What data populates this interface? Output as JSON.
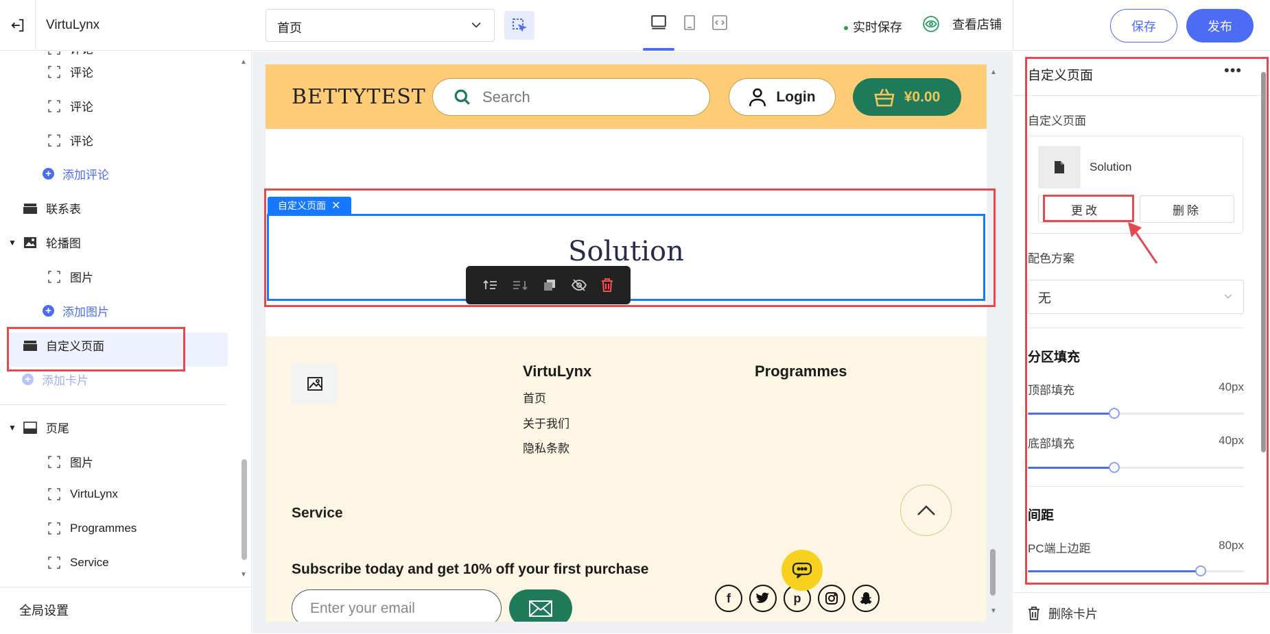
{
  "app": {
    "name": "VirtuLynx"
  },
  "topbar": {
    "page_select": "首页",
    "autosave": "实时保存",
    "view_store": "查看店铺",
    "save": "保存",
    "publish": "发布"
  },
  "sidebar": {
    "items": [
      {
        "label": "评论",
        "kind": "child"
      },
      {
        "label": "评论",
        "kind": "child"
      },
      {
        "label": "评论",
        "kind": "child"
      },
      {
        "label": "添加评论",
        "kind": "add"
      },
      {
        "label": "联系表",
        "kind": "section"
      },
      {
        "label": "轮播图",
        "kind": "group"
      },
      {
        "label": "图片",
        "kind": "child"
      },
      {
        "label": "添加图片",
        "kind": "add"
      },
      {
        "label": "自定义页面",
        "kind": "section",
        "selected": true
      },
      {
        "label": "添加卡片",
        "kind": "add-disabled"
      },
      {
        "label": "页尾",
        "kind": "group"
      },
      {
        "label": "图片",
        "kind": "child"
      },
      {
        "label": "VirtuLynx",
        "kind": "child"
      },
      {
        "label": "Programmes",
        "kind": "child"
      },
      {
        "label": "Service",
        "kind": "child"
      }
    ],
    "global_settings": "全局设置"
  },
  "preview": {
    "brand": "BETTYTEST",
    "search_placeholder": "Search",
    "login": "Login",
    "cart_total": "¥0.00",
    "section_tag": "自定义页面",
    "section_title": "Solution",
    "footer": {
      "col1_title": "VirtuLynx",
      "col1_links": [
        "首页",
        "关于我们",
        "隐私条款"
      ],
      "col2_title": "Programmes",
      "service": "Service",
      "subscribe": "Subscribe today and get 10% off your first purchase",
      "email_placeholder": "Enter your email",
      "social": [
        "facebook-icon",
        "twitter-icon",
        "pinterest-icon",
        "instagram-icon",
        "snapchat-icon"
      ]
    }
  },
  "right_panel": {
    "title": "自定义页面",
    "field_label": "自定义页面",
    "file_name": "Solution",
    "change_btn": "更改",
    "delete_btn": "删除",
    "color_scheme_label": "配色方案",
    "color_scheme_value": "无",
    "section_padding": "分区填充",
    "top_padding_label": "顶部填充",
    "top_padding_value": "40px",
    "top_padding_level": 0.4,
    "bottom_padding_label": "底部填充",
    "bottom_padding_value": "40px",
    "bottom_padding_level": 0.4,
    "spacing": "间距",
    "pc_top_margin_label": "PC端上边距",
    "pc_top_margin_value": "80px",
    "pc_top_margin_level": 0.8,
    "delete_card": "删除卡片"
  },
  "colors": {
    "accent": "#4c6cf5",
    "selection_blue": "#1677ff",
    "highlight_red": "#e5484d",
    "header_yellow": "#fecc77",
    "footer_cream": "#fef6e5",
    "brand_green": "#1f7a5a"
  }
}
